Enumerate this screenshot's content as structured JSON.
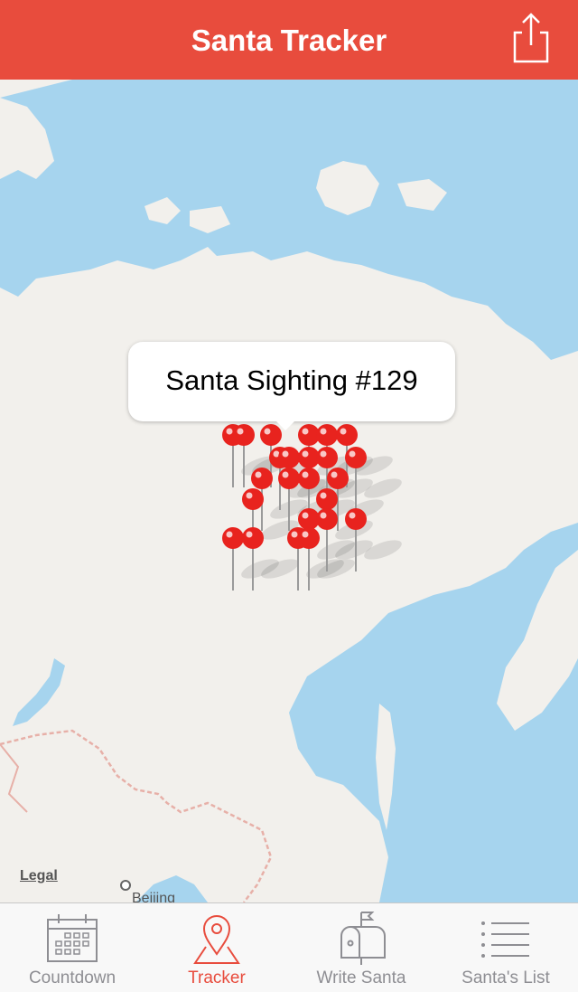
{
  "header": {
    "title": "Santa Tracker",
    "share_icon": "share-icon"
  },
  "map": {
    "callout": "Santa Sighting #129",
    "legal": "Legal",
    "city": "Beijing",
    "water_color": "#a6d4ee",
    "land_color": "#f2f0ec",
    "pin_color": "#e8231e"
  },
  "tabs": [
    {
      "label": "Countdown",
      "icon": "calendar-icon",
      "active": false
    },
    {
      "label": "Tracker",
      "icon": "map-pin-icon",
      "active": true
    },
    {
      "label": "Write Santa",
      "icon": "mailbox-icon",
      "active": false
    },
    {
      "label": "Santa's List",
      "icon": "list-icon",
      "active": false
    }
  ],
  "colors": {
    "accent": "#e84c3d",
    "inactive": "#8e8e93"
  }
}
